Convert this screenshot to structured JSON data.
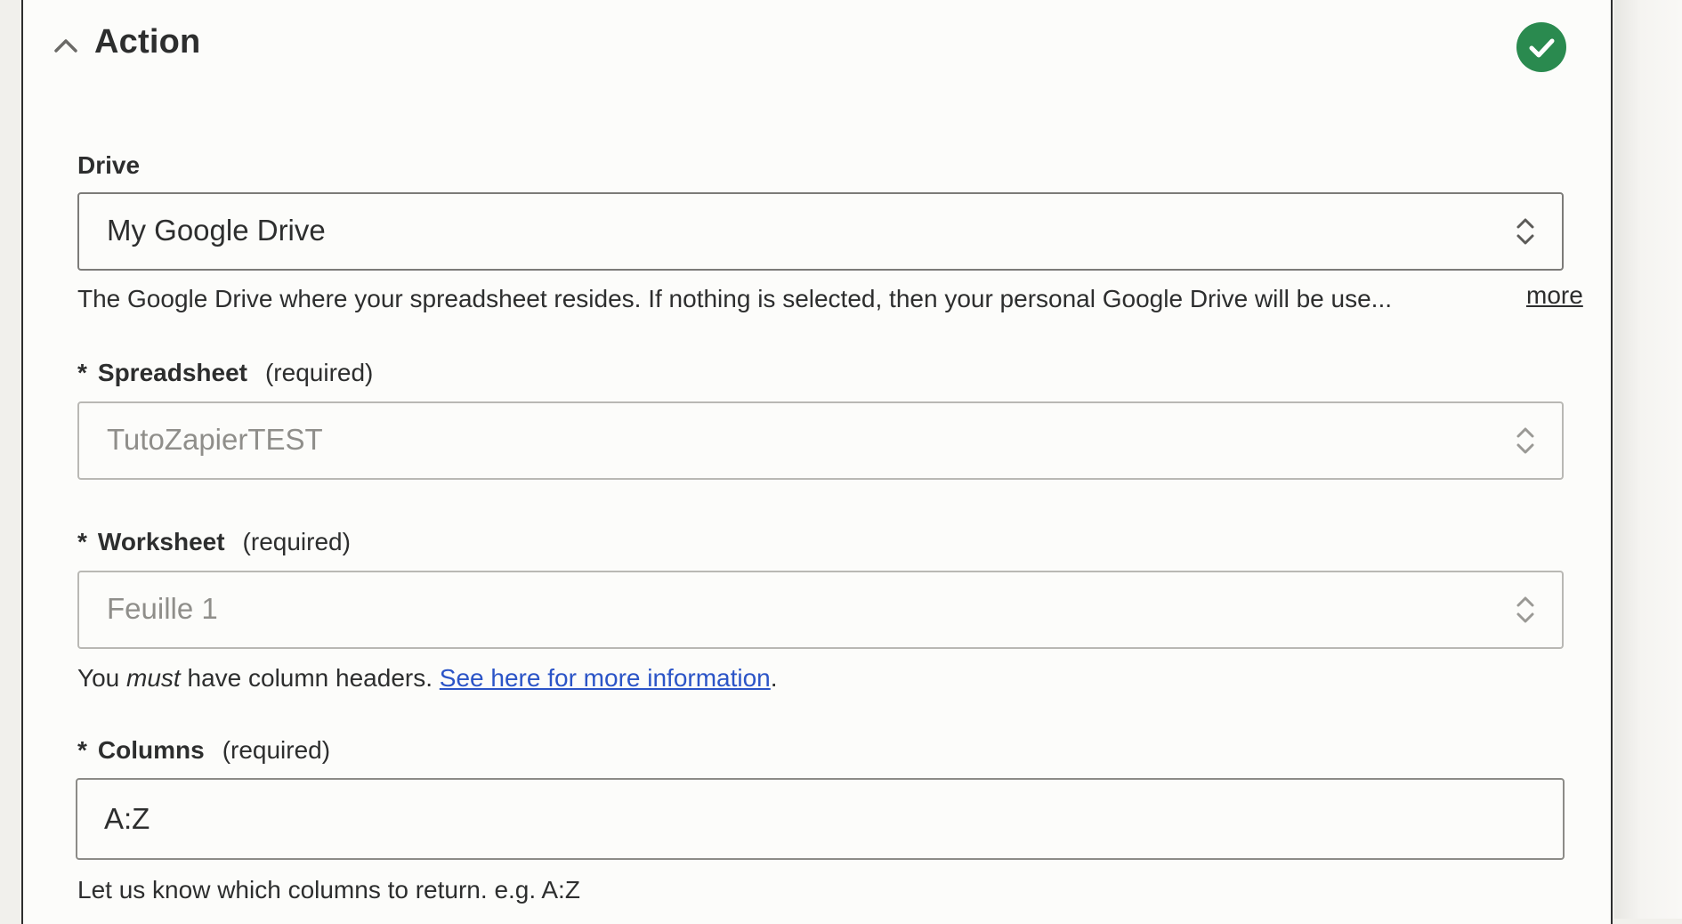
{
  "section": {
    "title": "Action",
    "status": "complete",
    "accent_color": "#2a8a4f"
  },
  "fields": {
    "drive": {
      "label": "Drive",
      "value": "My Google Drive",
      "help": "The Google Drive where your spreadsheet resides. If nothing is selected, then your personal Google Drive will be use...",
      "more_label": "more"
    },
    "spreadsheet": {
      "required_marker": "*",
      "label": "Spreadsheet",
      "required_note": "(required)",
      "value": "TutoZapierTEST"
    },
    "worksheet": {
      "required_marker": "*",
      "label": "Worksheet",
      "required_note": "(required)",
      "value": "Feuille 1",
      "help_prefix": "You",
      "help_emphasis": "must",
      "help_middle": "have column headers.",
      "help_link": "See here for more information",
      "help_suffix": "."
    },
    "columns": {
      "required_marker": "*",
      "label": "Columns",
      "required_note": "(required)",
      "value": "A:Z",
      "help": "Let us know which columns to return. e.g. A:Z"
    }
  },
  "icons": {
    "collapse": "chevron-up-icon",
    "status": "check-circle-icon",
    "select": "chevron-up-down-icon"
  },
  "colors": {
    "link": "#2b54c7",
    "success": "#2a8a4f"
  }
}
